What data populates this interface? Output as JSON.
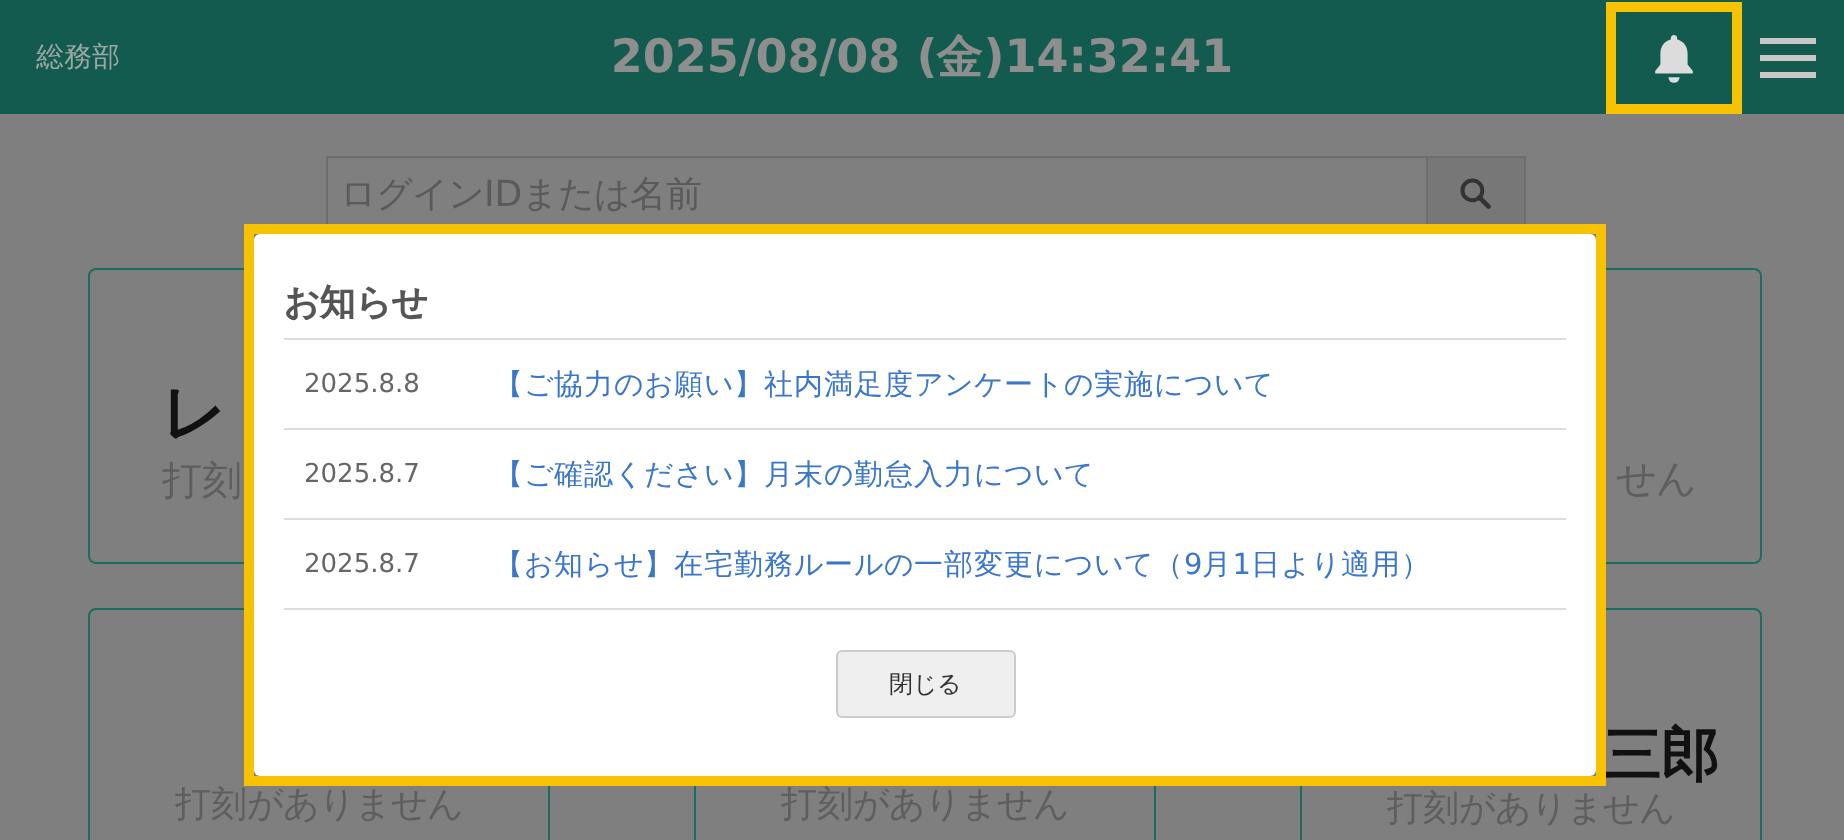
{
  "header": {
    "department": "総務部",
    "datetime": "2025/08/08 (金)14:32:41",
    "bell_highlighted": true
  },
  "search": {
    "placeholder": "ログインIDまたは名前"
  },
  "cards_row_1": [
    {
      "name": "レ",
      "status": "打刻"
    },
    {
      "status": "せん"
    }
  ],
  "cards_row_2": [
    {
      "status": "打刻がありません"
    },
    {
      "status": "打刻がありません"
    },
    {
      "name": "三郎",
      "status": "打刻がありません"
    }
  ],
  "modal": {
    "title": "お知らせ",
    "highlighted": true,
    "notices": [
      {
        "date": "2025.8.8",
        "title": "【ご協力のお願い】社内満足度アンケートの実施について"
      },
      {
        "date": "2025.8.7",
        "title": "【ご確認ください】月末の勤怠入力について"
      },
      {
        "date": "2025.8.7",
        "title": "【お知らせ】在宅勤務ルールの一部変更について（9月1日より適用）"
      }
    ],
    "close_button": "閉じる"
  }
}
